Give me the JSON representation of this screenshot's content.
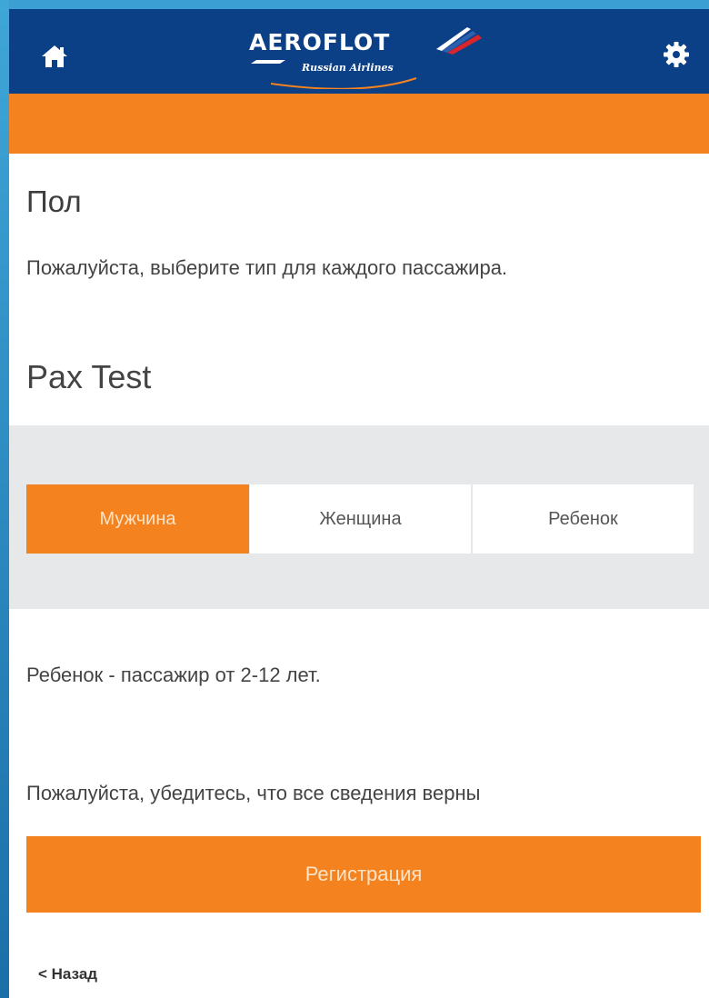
{
  "header": {
    "brand_name": "AEROFLOT",
    "brand_tagline": "Russian Airlines",
    "home_icon": "home-icon",
    "settings_icon": "gear-icon"
  },
  "colors": {
    "header_bg": "#0b3f86",
    "accent_orange": "#f4831f",
    "panel_gray": "#e6e8ea"
  },
  "main": {
    "title": "Пол",
    "instruction": "Пожалуйста, выберите тип для каждого пассажира.",
    "passenger_name": "Pax Test",
    "gender_options": [
      {
        "label": "Мужчина",
        "selected": true
      },
      {
        "label": "Женщина",
        "selected": false
      },
      {
        "label": "Ребенок",
        "selected": false
      }
    ],
    "child_note": "Ребенок - пассажир от 2-12 лет.",
    "confirm_text": "Пожалуйста, убедитесь, что все сведения верны",
    "register_label": "Регистрация",
    "back_label": "< Назад"
  }
}
